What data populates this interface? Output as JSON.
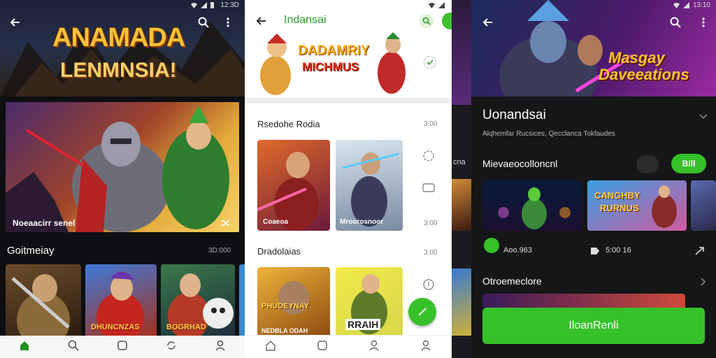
{
  "status": {
    "time": "12:3D"
  },
  "panel1": {
    "banner_title_1": "ANAMADA",
    "banner_title_2": "LENMNSIA!",
    "hero_caption": "Noeaacirr senel",
    "section_title": "Goitmeiay",
    "section_meta": "3D:000",
    "tile3_label": "DHUNCNZAS",
    "tile4_label": "BOGRHAD"
  },
  "panel2": {
    "app_title": "Indansai",
    "banner_title_1": "DADAMRIY",
    "banner_title_2": "MICHMUS",
    "section1_title": "Rsedohe Rodia",
    "section1_meta": "3:00",
    "card1_label": "Coaeoa",
    "card2_label": "Mroorosnoor",
    "side_meta": "3:00",
    "section2_title": "Dradolaias",
    "section2_meta": "3:00",
    "card3_label_1": "PHUDEYNAY",
    "card3_label_2": "NEDBLA ODAH",
    "card4_label": "RRAIH"
  },
  "strip": {
    "label": "cna",
    "time": "13:10"
  },
  "panel3": {
    "banner_title_1": "Masgay",
    "banner_title_2": "Daveeations",
    "app_title": "Uonandsai",
    "subtitle": "Alqhemfar Rucsices, Qecclanca Tokfaudes",
    "section1_title": "Mievaeocolloncnl",
    "toggle_label": "Bill",
    "card2_label_1": "CANGHBY",
    "card2_label_2": "RURNUS",
    "meta1": "Aoo.963",
    "meta2": "5:00 16",
    "section2_title": "Otroemeclore",
    "cta_label": "IloanRenli"
  },
  "colors": {
    "accent_green": "#36c12a",
    "dark_bg": "#151617",
    "title_gold": "#f7c23a"
  }
}
